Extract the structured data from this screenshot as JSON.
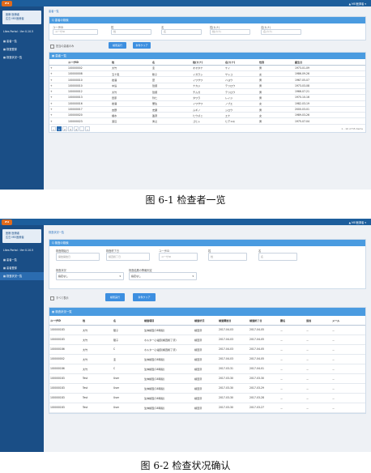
{
  "screen1": {
    "logo": "iFd",
    "user_menu": "▲ MEI医師者 ▾",
    "sidebar": {
      "user_line1": "医療 医療者",
      "user_line2": "広島 MEI医療者",
      "version": "Lites Portal : Ver 0.10.5",
      "items": [
        {
          "label": "▦ 患者一覧"
        },
        {
          "label": "▦ 検査登録"
        },
        {
          "label": "▦ 検査状況一覧"
        }
      ]
    },
    "breadcrumb": "患者一覧",
    "search_panel": {
      "title": "Q 患者の検索",
      "fields": [
        {
          "label": "ユーザID",
          "placeholder": "ユーザID"
        },
        {
          "label": "姓",
          "placeholder": "姓"
        },
        {
          "label": "名",
          "placeholder": "名"
        },
        {
          "label": "姓(カナ)",
          "placeholder": "姓(カナ)"
        },
        {
          "label": "名(カナ)",
          "placeholder": "名(カナ)"
        }
      ]
    },
    "actions": {
      "checkbox_label": "担当の患者のみ",
      "search_button": "検索実行",
      "clear_button": "条件クリア"
    },
    "list_panel": {
      "title": "▦ 患者一覧",
      "columns": [
        "",
        "ユーザID",
        "姓",
        "名",
        "姓(カナ)",
        "名(カナ)",
        "性別",
        "誕生日"
      ],
      "rows": [
        [
          "+",
          "100000002",
          "大竹",
          "圭",
          "オオタケ",
          "ケイ",
          "男",
          "1973-01-09"
        ],
        [
          "+",
          "100000008",
          "五十嵐",
          "聡子",
          "イガラシ",
          "サトコ",
          "女",
          "1986-09-26"
        ],
        [
          "+",
          "100000010",
          "岩澤",
          "葉",
          "イワサワ",
          "ハヨウ",
          "男",
          "1967-05-07"
        ],
        [
          "+",
          "100000010",
          "中島",
          "哲郎",
          "ナカジ",
          "テツロウ",
          "男",
          "1973-03-08"
        ],
        [
          "+",
          "100000012",
          "大竹",
          "哲郎",
          "チムガ",
          "テツロウ",
          "男",
          "1966-07-21"
        ],
        [
          "+",
          "100000013",
          "田原",
          "玲仁",
          "タワラ",
          "レイジ",
          "男",
          "1970-10-16"
        ],
        [
          "+",
          "100000016",
          "岩澤",
          "華生",
          "イワサワ",
          "ノブエ",
          "女",
          "1982-03-19"
        ],
        [
          "+",
          "100000017",
          "吉野",
          "史朗",
          "ムギノ",
          "シロウ",
          "男",
          "2000-03-01"
        ],
        [
          "+",
          "100000020",
          "樋水",
          "盈奈",
          "ヒウズミ",
          "エナ",
          "女",
          "1989-03-26"
        ],
        [
          "+",
          "100000023",
          "渡辺",
          "秀之",
          "ゴヒト",
          "ヒデユキ",
          "男",
          "1975-07-04"
        ]
      ],
      "pager": {
        "pages": [
          "«",
          "1",
          "2",
          "3",
          "4",
          "…",
          "»"
        ],
        "info": "1 - 10 of 55 items"
      }
    }
  },
  "caption1": "图 6-1 检查者一览",
  "screen2": {
    "logo": "iFd",
    "user_menu": "▲ MEI医師者 ▾",
    "sidebar": {
      "user_line1": "医療 医療者",
      "user_line2": "広島 MEI医療者",
      "version": "Lites Portal : Ver 0.10.5",
      "items": [
        {
          "label": "▦ 患者一覧"
        },
        {
          "label": "▦ 患者登録"
        },
        {
          "label": "▦ 検査状況一覧"
        }
      ]
    },
    "breadcrumb": "検査状況一覧",
    "search_panel": {
      "title": "Q 検査の検索",
      "fields": [
        {
          "label": "検査開始日",
          "placeholder": "開始開始日"
        },
        {
          "label": "検査終了日",
          "placeholder": "検査終了日"
        },
        {
          "label": "ユーザID",
          "placeholder": "ユーザID"
        },
        {
          "label": "姓",
          "placeholder": "姓"
        },
        {
          "label": "名",
          "placeholder": "名"
        }
      ],
      "selects": [
        {
          "label": "検査状況",
          "value": "指定なし"
        },
        {
          "label": "検査結果の警報判定",
          "value": "指定なし"
        }
      ]
    },
    "actions": {
      "checkbox_label": "すべて表示",
      "search_button": "検索実行",
      "clear_button": "条件クリア"
    },
    "list_panel": {
      "title": "▦ 検査状況一覧",
      "columns": [
        "ユーザID",
        "姓",
        "名",
        "検査項目",
        "検査状況",
        "検査開始日",
        "検査終了日",
        "腰名",
        "追加",
        "メール"
      ],
      "rows": [
        [
          "100000183",
          "大竹",
          "陸子",
          "生体検査(14時間)",
          "検査済",
          "2017-04-03",
          "2017-04-05",
          "－",
          "－",
          "－"
        ],
        [
          "100000183",
          "大竹",
          "陸子",
          "ホルター心電図(検査終了済)",
          "検査済",
          "2017-04-03",
          "2017-04-05",
          "－",
          "－",
          "－"
        ],
        [
          "100000186",
          "大竹",
          "C",
          "ホルター心電図(検査終了済)",
          "検査済",
          "2017-04-03",
          "2017-04-05",
          "－",
          "－",
          "－"
        ],
        [
          "100000002",
          "大竹",
          "圭",
          "生体検査(14時間)",
          "検査済",
          "2017-04-03",
          "2017-04-05",
          "－",
          "－",
          "－"
        ],
        [
          "100000186",
          "大竹",
          "C",
          "生体検査(14時間)",
          "検査済",
          "2017-03-31",
          "2017-04-01",
          "－",
          "－",
          "－"
        ],
        [
          "100000183",
          "Test",
          "User",
          "生体検査(14時間)",
          "検査済",
          "2017-03-30",
          "2017-03-30",
          "－",
          "－",
          "－"
        ],
        [
          "100000183",
          "Test",
          "User",
          "生体検査(14時間)",
          "検査済",
          "2017-03-30",
          "2017-03-29",
          "－",
          "－",
          "－"
        ],
        [
          "100000183",
          "Test",
          "User",
          "生体検査(14時間)",
          "検査済",
          "2017-03-30",
          "2017-03-28",
          "－",
          "－",
          "－"
        ],
        [
          "100000183",
          "Test",
          "User",
          "生体検査(14時間)",
          "検査済",
          "2017-03-30",
          "2017-03-27",
          "－",
          "－",
          "－"
        ]
      ]
    }
  },
  "caption2": "图 6-2 检查状况确认",
  "colors": {
    "topbar": "#1d5e9c",
    "sidebar": "#1a4e86",
    "panel_header": "#4a9be0",
    "button": "#3d8fe0",
    "logo": "#e06a1c"
  }
}
